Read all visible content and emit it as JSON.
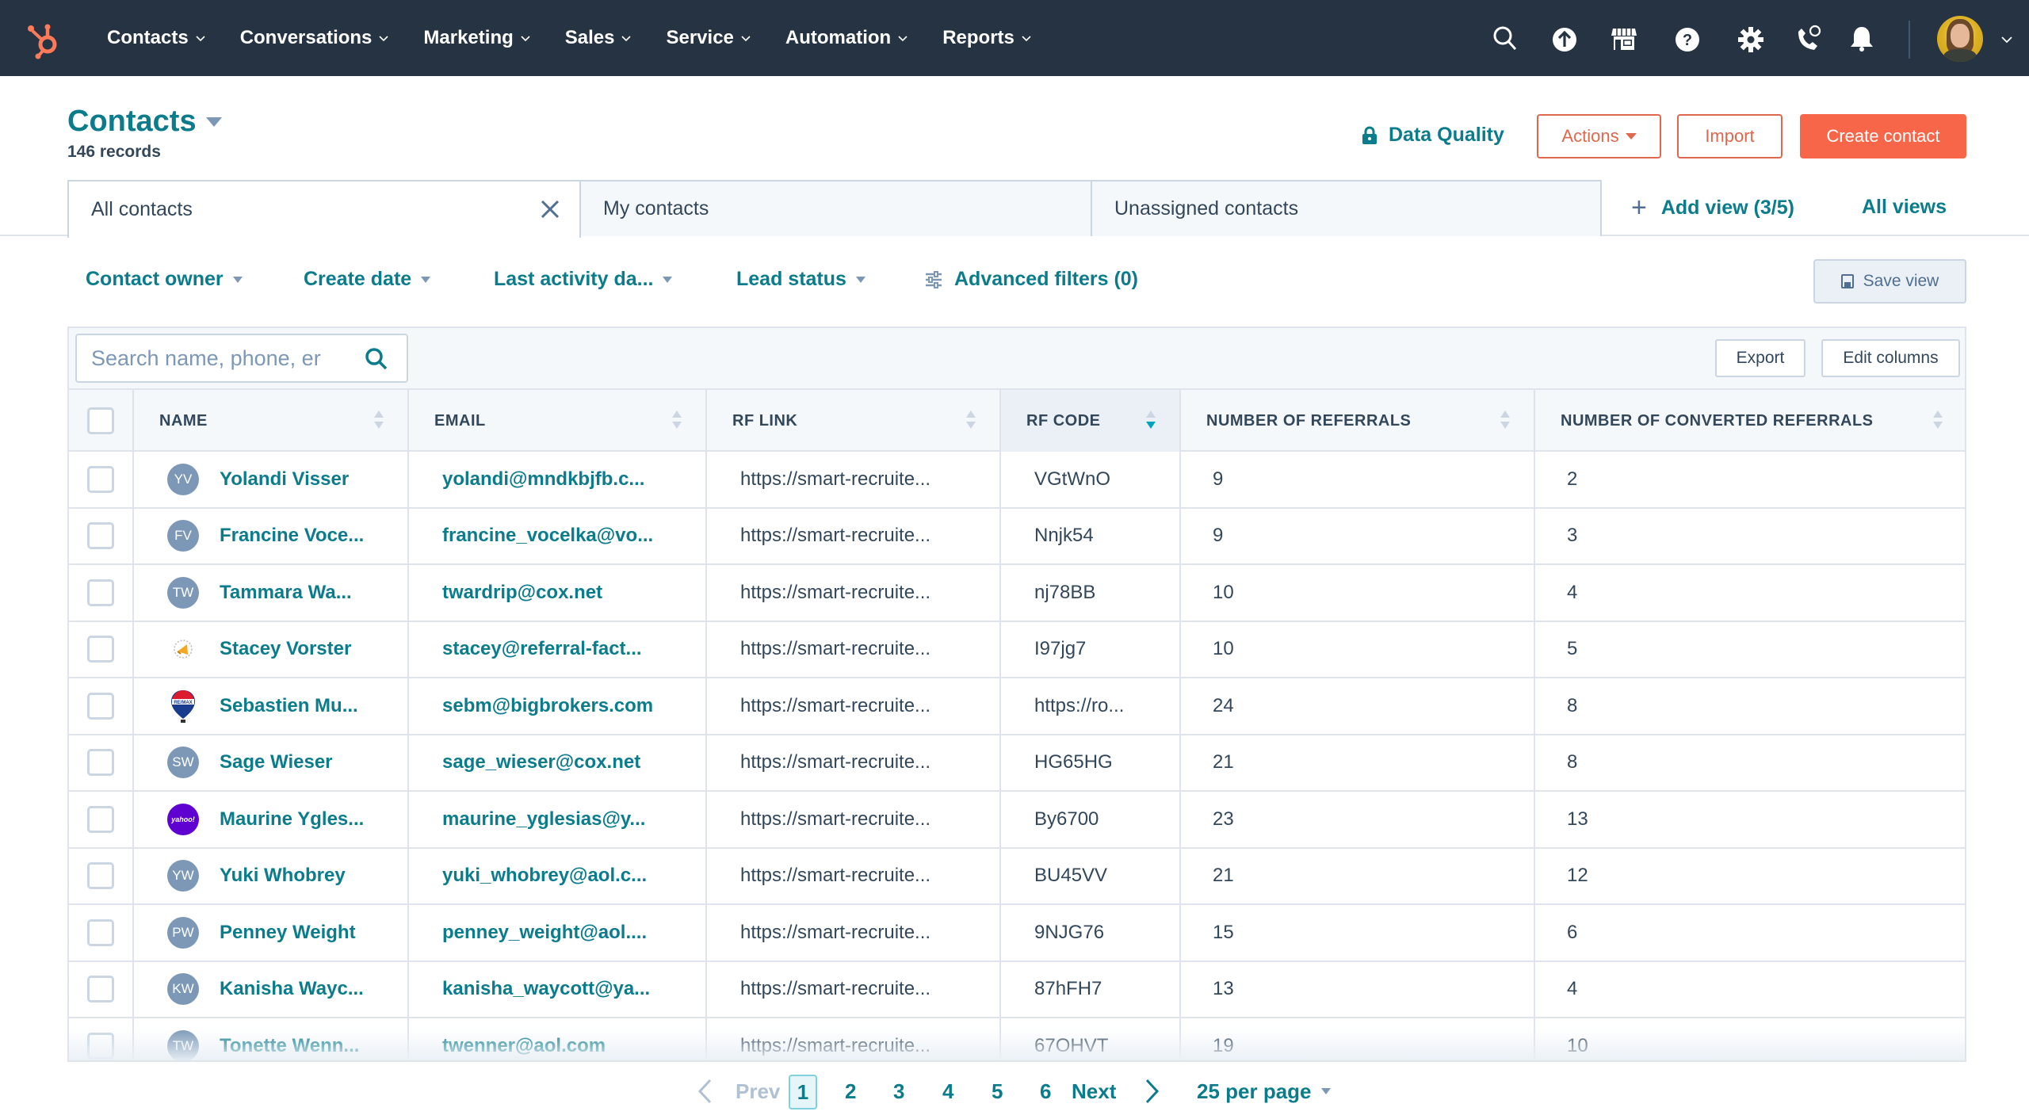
{
  "nav": {
    "items": [
      "Contacts",
      "Conversations",
      "Marketing",
      "Sales",
      "Service",
      "Automation",
      "Reports"
    ],
    "icons": [
      "search-icon",
      "upgrade-icon",
      "marketplace-icon",
      "help-icon",
      "settings-icon",
      "calling-icon",
      "notifications-icon"
    ]
  },
  "header": {
    "title": "Contacts",
    "records": "146 records",
    "data_quality": "Data Quality",
    "actions": "Actions",
    "import": "Import",
    "create": "Create contact"
  },
  "tabs": {
    "items": [
      "All contacts",
      "My contacts",
      "Unassigned contacts"
    ],
    "active": "All contacts",
    "add_view": "Add view (3/5)",
    "all_views": "All views"
  },
  "filters": {
    "items": [
      "Contact owner",
      "Create date",
      "Last activity da...",
      "Lead status"
    ],
    "advanced": "Advanced filters (0)",
    "save_view": "Save view"
  },
  "table": {
    "search_placeholder": "Search name, phone, er",
    "export": "Export",
    "edit_columns": "Edit columns",
    "columns": [
      "NAME",
      "EMAIL",
      "RF LINK",
      "RF CODE",
      "NUMBER OF REFERRALS",
      "NUMBER OF CONVERTED REFERRALS"
    ],
    "sorted_column": "RF CODE",
    "sort_direction": "descending",
    "rows": [
      {
        "initials": "YV",
        "avatar": "initials",
        "name": "Yolandi Visser",
        "email": "yolandi@mndkbjfb.c...",
        "rf_link": "https://smart-recruite...",
        "rf_code": "VGtWnO",
        "referrals": "9",
        "converted": "2"
      },
      {
        "initials": "FV",
        "avatar": "initials",
        "name": "Francine Voce...",
        "email": "francine_vocelka@vo...",
        "rf_link": "https://smart-recruite...",
        "rf_code": "Nnjk54",
        "referrals": "9",
        "converted": "3"
      },
      {
        "initials": "TW",
        "avatar": "initials",
        "name": "Tammara Wa...",
        "email": "twardrip@cox.net",
        "rf_link": "https://smart-recruite...",
        "rf_code": "nj78BB",
        "referrals": "10",
        "converted": "4"
      },
      {
        "initials": "",
        "avatar": "company-logo-megaphone",
        "name": "Stacey Vorster",
        "email": "stacey@referral-fact...",
        "rf_link": "https://smart-recruite...",
        "rf_code": "I97jg7",
        "referrals": "10",
        "converted": "5"
      },
      {
        "initials": "",
        "avatar": "company-logo-remax",
        "name": "Sebastien Mu...",
        "email": "sebm@bigbrokers.com",
        "rf_link": "https://smart-recruite...",
        "rf_code": "https://ro...",
        "referrals": "24",
        "converted": "8"
      },
      {
        "initials": "SW",
        "avatar": "initials",
        "name": "Sage Wieser",
        "email": "sage_wieser@cox.net",
        "rf_link": "https://smart-recruite...",
        "rf_code": "HG65HG",
        "referrals": "21",
        "converted": "8"
      },
      {
        "initials": "yahoo!",
        "avatar": "company-logo-yahoo",
        "name": "Maurine Ygles...",
        "email": "maurine_yglesias@y...",
        "rf_link": "https://smart-recruite...",
        "rf_code": "By6700",
        "referrals": "23",
        "converted": "13"
      },
      {
        "initials": "YW",
        "avatar": "initials",
        "name": "Yuki Whobrey",
        "email": "yuki_whobrey@aol.c...",
        "rf_link": "https://smart-recruite...",
        "rf_code": "BU45VV",
        "referrals": "21",
        "converted": "12"
      },
      {
        "initials": "PW",
        "avatar": "initials",
        "name": "Penney Weight",
        "email": "penney_weight@aol....",
        "rf_link": "https://smart-recruite...",
        "rf_code": "9NJG76",
        "referrals": "15",
        "converted": "6"
      },
      {
        "initials": "KW",
        "avatar": "initials",
        "name": "Kanisha Wayc...",
        "email": "kanisha_waycott@ya...",
        "rf_link": "https://smart-recruite...",
        "rf_code": "87hFH7",
        "referrals": "13",
        "converted": "4"
      },
      {
        "initials": "TW",
        "avatar": "initials",
        "name": "Tonette Wenn...",
        "email": "twenner@aol.com",
        "rf_link": "https://smart-recruite...",
        "rf_code": "67OHVT",
        "referrals": "19",
        "converted": "10"
      }
    ]
  },
  "pagination": {
    "prev": "Prev",
    "pages": [
      "1",
      "2",
      "3",
      "4",
      "5",
      "6"
    ],
    "current": "1",
    "next": "Next",
    "per_page": "25 per page"
  },
  "colors": {
    "nav_bg": "#253342",
    "accent_teal": "#0b7c8c",
    "primary_orange": "#f8664a",
    "text": "#33475b",
    "border": "#dfe3eb"
  }
}
